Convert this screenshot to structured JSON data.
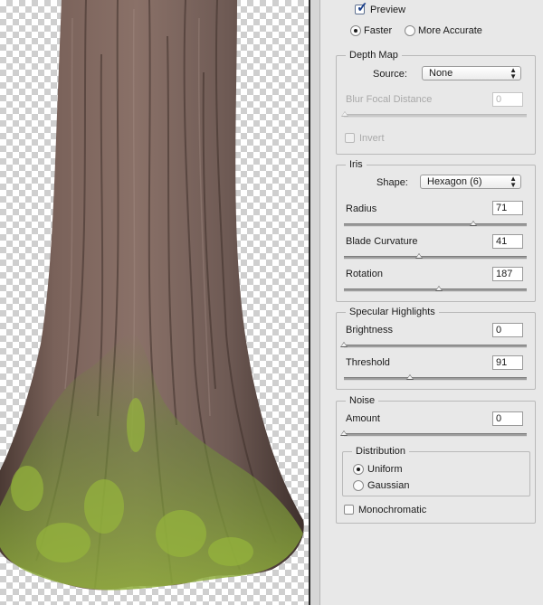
{
  "preview": {
    "label": "Preview",
    "checked": true
  },
  "quality": {
    "options": [
      "Faster",
      "More Accurate"
    ],
    "selected": "Faster"
  },
  "depth_map": {
    "title": "Depth Map",
    "source_label": "Source:",
    "source_value": "None",
    "blur_label": "Blur Focal Distance",
    "blur_value": "0",
    "blur_slider": 0,
    "invert_label": "Invert",
    "invert_checked": false
  },
  "iris": {
    "title": "Iris",
    "shape_label": "Shape:",
    "shape_value": "Hexagon (6)",
    "sliders": [
      {
        "label": "Radius",
        "value": "71",
        "fraction": 0.71
      },
      {
        "label": "Blade Curvature",
        "value": "41",
        "fraction": 0.41
      },
      {
        "label": "Rotation",
        "value": "187",
        "fraction": 0.52
      }
    ]
  },
  "specular": {
    "title": "Specular Highlights",
    "sliders": [
      {
        "label": "Brightness",
        "value": "0",
        "fraction": 0.0
      },
      {
        "label": "Threshold",
        "value": "91",
        "fraction": 0.36
      }
    ]
  },
  "noise": {
    "title": "Noise",
    "amount_label": "Amount",
    "amount_value": "0",
    "amount_fraction": 0.0,
    "distribution_title": "Distribution",
    "distribution_options": [
      "Uniform",
      "Gaussian"
    ],
    "distribution_selected": "Uniform",
    "monochromatic_label": "Monochromatic",
    "monochromatic_checked": false
  },
  "colors": {
    "panel_bg": "#e8e8e8",
    "bark": "#6f5a50",
    "moss": "#7e9a35"
  }
}
